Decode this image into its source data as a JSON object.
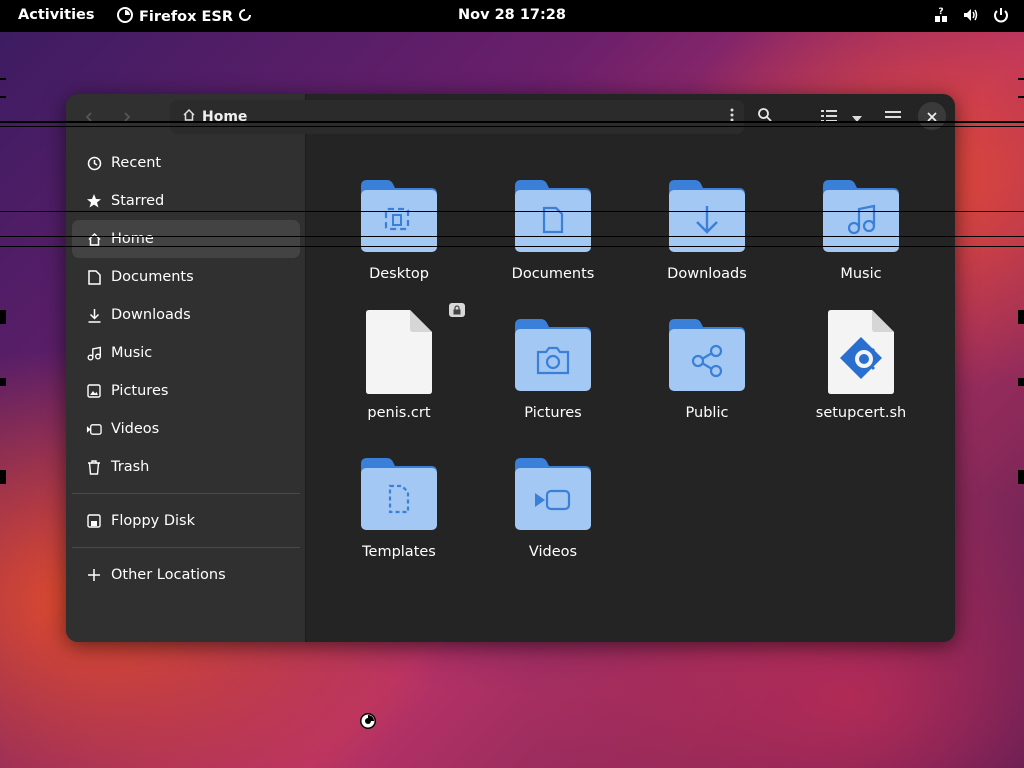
{
  "topbar": {
    "activities": "Activities",
    "app_name": "Firefox ESR",
    "datetime": "Nov 28  17:28",
    "icons": [
      "accessibility-icon",
      "volume-icon",
      "power-icon"
    ]
  },
  "window": {
    "path": "Home",
    "header_icons": [
      "back-arrow-icon",
      "forward-arrow-icon",
      "home-icon",
      "kebab-menu-icon",
      "search-icon",
      "list-view-icon",
      "chevron-down-icon",
      "hamburger-menu-icon",
      "close-icon"
    ]
  },
  "sidebar": {
    "items": [
      {
        "label": "Recent",
        "icon": "clock-icon"
      },
      {
        "label": "Starred",
        "icon": "star-icon"
      },
      {
        "label": "Home",
        "icon": "home-icon",
        "active": true
      },
      {
        "label": "Documents",
        "icon": "document-icon"
      },
      {
        "label": "Downloads",
        "icon": "download-icon"
      },
      {
        "label": "Music",
        "icon": "music-icon"
      },
      {
        "label": "Pictures",
        "icon": "picture-icon"
      },
      {
        "label": "Videos",
        "icon": "video-icon"
      },
      {
        "label": "Trash",
        "icon": "trash-icon"
      }
    ],
    "devices": [
      {
        "label": "Floppy Disk",
        "icon": "floppy-icon"
      }
    ],
    "other": [
      {
        "label": "Other Locations",
        "icon": "plus-icon"
      }
    ]
  },
  "files": [
    {
      "label": "Desktop",
      "type": "folder",
      "glyph": "desktop"
    },
    {
      "label": "Documents",
      "type": "folder",
      "glyph": "document"
    },
    {
      "label": "Downloads",
      "type": "folder",
      "glyph": "download"
    },
    {
      "label": "Music",
      "type": "folder",
      "glyph": "music"
    },
    {
      "label": "penis.crt",
      "type": "file",
      "glyph": "blank",
      "locked": true
    },
    {
      "label": "Pictures",
      "type": "folder",
      "glyph": "camera"
    },
    {
      "label": "Public",
      "type": "folder",
      "glyph": "share"
    },
    {
      "label": "setupcert.sh",
      "type": "script",
      "glyph": "gear"
    },
    {
      "label": "Templates",
      "type": "folder",
      "glyph": "template"
    },
    {
      "label": "Videos",
      "type": "folder",
      "glyph": "video"
    }
  ],
  "colors": {
    "folder_back": "#3a7fd8",
    "folder_front": "#a3c8f3",
    "folder_glyph": "#3a7fd8",
    "window_bg": "#242424",
    "sidebar_bg": "#303030"
  }
}
